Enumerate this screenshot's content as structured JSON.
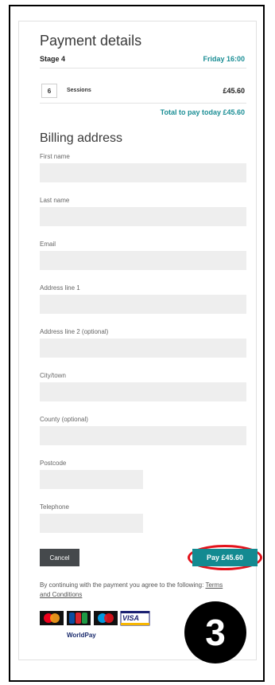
{
  "payment": {
    "title": "Payment details",
    "stage": "Stage 4",
    "date_time": "Friday 16:00",
    "quantity": "6",
    "item_label": "Sessions",
    "item_price": "£45.60",
    "total_text": "Total to pay today £45.60"
  },
  "billing": {
    "title": "Billing address",
    "fields": {
      "first_name": "First name",
      "last_name": "Last name",
      "email": "Email",
      "address1": "Address line 1",
      "address2": "Address line 2 (optional)",
      "city": "City/town",
      "county": "County (optional)",
      "postcode": "Postcode",
      "telephone": "Telephone"
    }
  },
  "actions": {
    "cancel_label": "Cancel",
    "pay_label": "Pay £45.60"
  },
  "terms": {
    "text": "By continuing with the payment you agree to the following:",
    "link": "Terms and Conditions"
  },
  "payment_logos": {
    "visa_text": "VISA",
    "worldpay_label": "WorldPay"
  },
  "step_badge": "3",
  "colors": {
    "accent": "#138a91",
    "highlight_ring": "#e3121b",
    "cancel_button": "#45494c",
    "field_bg": "#eeeeee"
  }
}
